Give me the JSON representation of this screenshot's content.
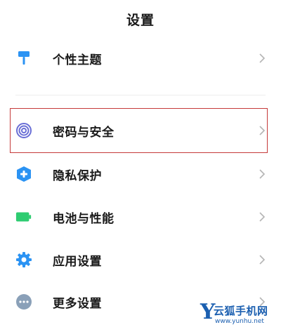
{
  "header": {
    "title": "设置"
  },
  "settings": {
    "items": [
      {
        "label": "个性主题",
        "icon": "paint-roller-icon",
        "color": "#2b93f3"
      },
      {
        "label": "密码与安全",
        "icon": "fingerprint-icon",
        "color": "#6a6fd6"
      },
      {
        "label": "隐私保护",
        "icon": "privacy-shield-icon",
        "color": "#2b93f3"
      },
      {
        "label": "电池与性能",
        "icon": "battery-icon",
        "color": "#2ecc71"
      },
      {
        "label": "应用设置",
        "icon": "gear-icon",
        "color": "#2b93f3"
      },
      {
        "label": "更多设置",
        "icon": "more-dots-icon",
        "color": "#7c8fa6"
      }
    ],
    "highlighted_item": "密码与安全",
    "highlight_color": "#c53a3a"
  },
  "watermark": {
    "letter": "Y",
    "name": "云狐手机网",
    "url": "www.yunhu.net",
    "color": "#1b5fb0"
  }
}
